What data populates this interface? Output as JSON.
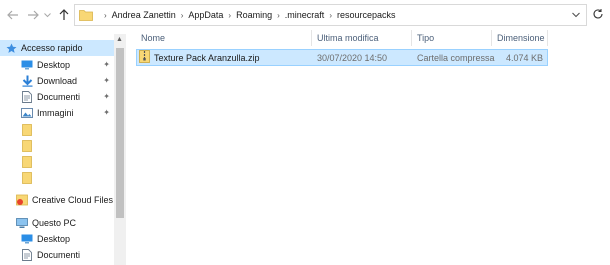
{
  "toolbar": {
    "back_icon": "arrow-left-icon",
    "forward_icon": "arrow-right-icon",
    "recent_icon": "chevron-down-icon",
    "up_icon": "arrow-up-icon",
    "refresh_icon": "refresh-icon"
  },
  "address": {
    "segments": [
      "Andrea Zanettin",
      "AppData",
      "Roaming",
      ".minecraft",
      "resourcepacks"
    ]
  },
  "sidebar": {
    "items": [
      {
        "label": "Accesso rapido",
        "icon": "star-icon",
        "pinned": false
      },
      {
        "label": "Desktop",
        "icon": "desktop-icon",
        "pinned": true
      },
      {
        "label": "Download",
        "icon": "download-icon",
        "pinned": true
      },
      {
        "label": "Documenti",
        "icon": "documents-icon",
        "pinned": true
      },
      {
        "label": "Immagini",
        "icon": "pictures-icon",
        "pinned": true
      },
      {
        "label": "",
        "icon": "folder-icon",
        "pinned": false
      },
      {
        "label": "",
        "icon": "folder-icon",
        "pinned": false
      },
      {
        "label": "",
        "icon": "folder-icon",
        "pinned": false
      },
      {
        "label": "",
        "icon": "folder-icon",
        "pinned": false
      },
      {
        "label": "Creative Cloud Files",
        "icon": "creative-cloud-icon",
        "pinned": false
      },
      {
        "label": "Questo PC",
        "icon": "computer-icon",
        "pinned": false
      },
      {
        "label": "Desktop",
        "icon": "desktop-icon",
        "pinned": false
      },
      {
        "label": "Documenti",
        "icon": "documents-icon",
        "pinned": false
      }
    ]
  },
  "columns": {
    "name": "Nome",
    "modified": "Ultima modifica",
    "type": "Tipo",
    "size": "Dimensione"
  },
  "files": [
    {
      "name": "Texture Pack Aranzulla.zip",
      "modified": "30/07/2020 14:50",
      "type": "Cartella compressa",
      "size": "4.074 KB",
      "icon": "zip-folder-icon",
      "selected": true
    }
  ],
  "colors": {
    "selection": "#cce8ff",
    "selection_border": "#99d1ff",
    "folder": "#f8d775"
  }
}
